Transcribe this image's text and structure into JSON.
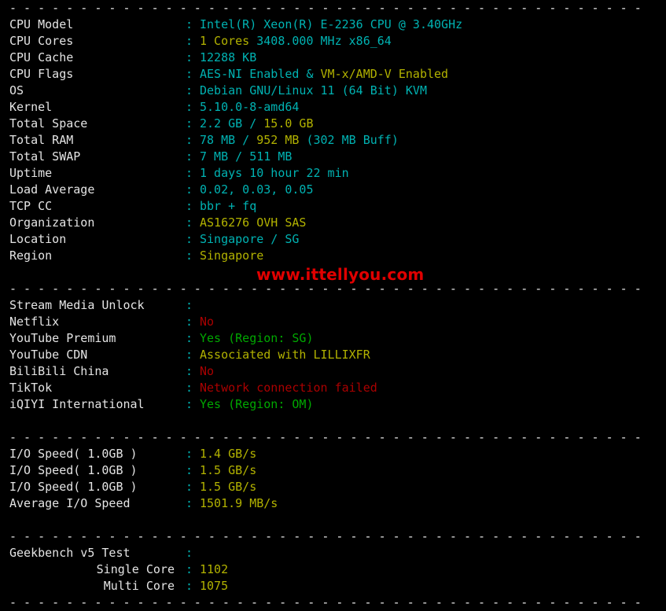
{
  "terminal": {
    "separator_line": "---------------------------------------------------------------",
    "watermark": "www.ittellyou.com",
    "colon": ":",
    "sections": [
      {
        "name": "system-info",
        "rows": [
          {
            "label": "CPU Model",
            "parts": [
              {
                "text": "Intel(R) Xeon(R) E-2236 CPU @ 3.40GHz",
                "color": "cy"
              }
            ]
          },
          {
            "label": "CPU Cores",
            "parts": [
              {
                "text": "1 Cores ",
                "color": "ye"
              },
              {
                "text": "3408.000 MHz x86_64",
                "color": "cy"
              }
            ]
          },
          {
            "label": "CPU Cache",
            "parts": [
              {
                "text": "12288 KB",
                "color": "cy"
              }
            ]
          },
          {
            "label": "CPU Flags",
            "parts": [
              {
                "text": "AES-NI Enabled ",
                "color": "cy"
              },
              {
                "text": "& ",
                "color": "cy"
              },
              {
                "text": "VM-x/AMD-V Enabled",
                "color": "ye"
              }
            ]
          },
          {
            "label": "OS",
            "parts": [
              {
                "text": "Debian GNU/Linux 11 (64 Bit) KVM",
                "color": "cy"
              }
            ]
          },
          {
            "label": "Kernel",
            "parts": [
              {
                "text": "5.10.0-8-amd64",
                "color": "cy"
              }
            ]
          },
          {
            "label": "Total Space",
            "parts": [
              {
                "text": "2.2 GB / ",
                "color": "cy"
              },
              {
                "text": "15.0 GB",
                "color": "ye"
              }
            ]
          },
          {
            "label": "Total RAM",
            "parts": [
              {
                "text": "78 MB / ",
                "color": "cy"
              },
              {
                "text": "952 MB ",
                "color": "ye"
              },
              {
                "text": "(302 MB Buff)",
                "color": "cy"
              }
            ]
          },
          {
            "label": "Total SWAP",
            "parts": [
              {
                "text": "7 MB / 511 MB",
                "color": "cy"
              }
            ]
          },
          {
            "label": "Uptime",
            "parts": [
              {
                "text": "1 days 10 hour 22 min",
                "color": "cy"
              }
            ]
          },
          {
            "label": "Load Average",
            "parts": [
              {
                "text": "0.02, 0.03, 0.05",
                "color": "cy"
              }
            ]
          },
          {
            "label": "TCP CC",
            "parts": [
              {
                "text": "bbr + fq",
                "color": "cy"
              }
            ]
          },
          {
            "label": "Organization",
            "parts": [
              {
                "text": "AS16276 OVH SAS",
                "color": "ye"
              }
            ]
          },
          {
            "label": "Location",
            "parts": [
              {
                "text": "Singapore / SG",
                "color": "cy"
              }
            ]
          },
          {
            "label": "Region",
            "parts": [
              {
                "text": "Singapore",
                "color": "ye"
              }
            ]
          }
        ]
      },
      {
        "name": "stream-media-unlock",
        "rows": [
          {
            "label": "Stream Media Unlock",
            "parts": []
          },
          {
            "label": "Netflix",
            "parts": [
              {
                "text": "No",
                "color": "rd"
              }
            ]
          },
          {
            "label": "YouTube Premium",
            "parts": [
              {
                "text": "Yes (Region: SG)",
                "color": "gr"
              }
            ]
          },
          {
            "label": "YouTube CDN",
            "parts": [
              {
                "text": "Associated with LILLIXFR",
                "color": "ye"
              }
            ]
          },
          {
            "label": "BiliBili China",
            "parts": [
              {
                "text": "No",
                "color": "rd"
              }
            ]
          },
          {
            "label": "TikTok",
            "parts": [
              {
                "text": "Network connection failed",
                "color": "rd"
              }
            ]
          },
          {
            "label": "iQIYI International",
            "parts": [
              {
                "text": "Yes (Region: OM)",
                "color": "gr"
              }
            ]
          }
        ]
      },
      {
        "name": "io-speed",
        "rows": [
          {
            "label": "I/O Speed( 1.0GB )",
            "parts": [
              {
                "text": "1.4 GB/s",
                "color": "ye"
              }
            ]
          },
          {
            "label": "I/O Speed( 1.0GB )",
            "parts": [
              {
                "text": "1.5 GB/s",
                "color": "ye"
              }
            ]
          },
          {
            "label": "I/O Speed( 1.0GB )",
            "parts": [
              {
                "text": "1.5 GB/s",
                "color": "ye"
              }
            ]
          },
          {
            "label": "Average I/O Speed",
            "parts": [
              {
                "text": "1501.9 MB/s",
                "color": "ye"
              }
            ]
          }
        ]
      },
      {
        "name": "geekbench",
        "rows": [
          {
            "label": "Geekbench v5 Test",
            "parts": []
          },
          {
            "label": "Single Core",
            "indent": true,
            "parts": [
              {
                "text": "1102",
                "color": "ye"
              }
            ]
          },
          {
            "label": "Multi Core",
            "indent": true,
            "parts": [
              {
                "text": "1075",
                "color": "ye"
              }
            ]
          }
        ]
      }
    ]
  }
}
